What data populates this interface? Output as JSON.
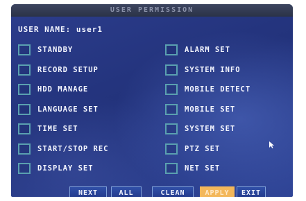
{
  "window": {
    "title": "USER PERMISSION"
  },
  "user": {
    "label": "USER NAME: user1"
  },
  "permissions_left": [
    {
      "label": "STANDBY",
      "checked": false
    },
    {
      "label": "RECORD SETUP",
      "checked": false
    },
    {
      "label": "HDD MANAGE",
      "checked": false
    },
    {
      "label": "LANGUAGE SET",
      "checked": false
    },
    {
      "label": "TIME SET",
      "checked": false
    },
    {
      "label": "START/STOP REC",
      "checked": false
    },
    {
      "label": "DISPLAY SET",
      "checked": false
    }
  ],
  "permissions_right": [
    {
      "label": "ALARM SET",
      "checked": false
    },
    {
      "label": "SYSTEM INFO",
      "checked": false
    },
    {
      "label": "MOBILE DETECT",
      "checked": false
    },
    {
      "label": "MOBILE SET",
      "checked": false
    },
    {
      "label": "SYSTEM SET",
      "checked": false
    },
    {
      "label": "PTZ SET",
      "checked": false
    },
    {
      "label": "NET SET",
      "checked": false
    }
  ],
  "buttons": {
    "next": "NEXT",
    "all": "ALL",
    "clean": "CLEAN",
    "apply": "APPLY",
    "exit": "EXIT"
  },
  "colors": {
    "background": "#23337c",
    "checkbox_border": "#5aa0b0",
    "highlight": "#f3b75a",
    "text": "#f4f6ff"
  }
}
